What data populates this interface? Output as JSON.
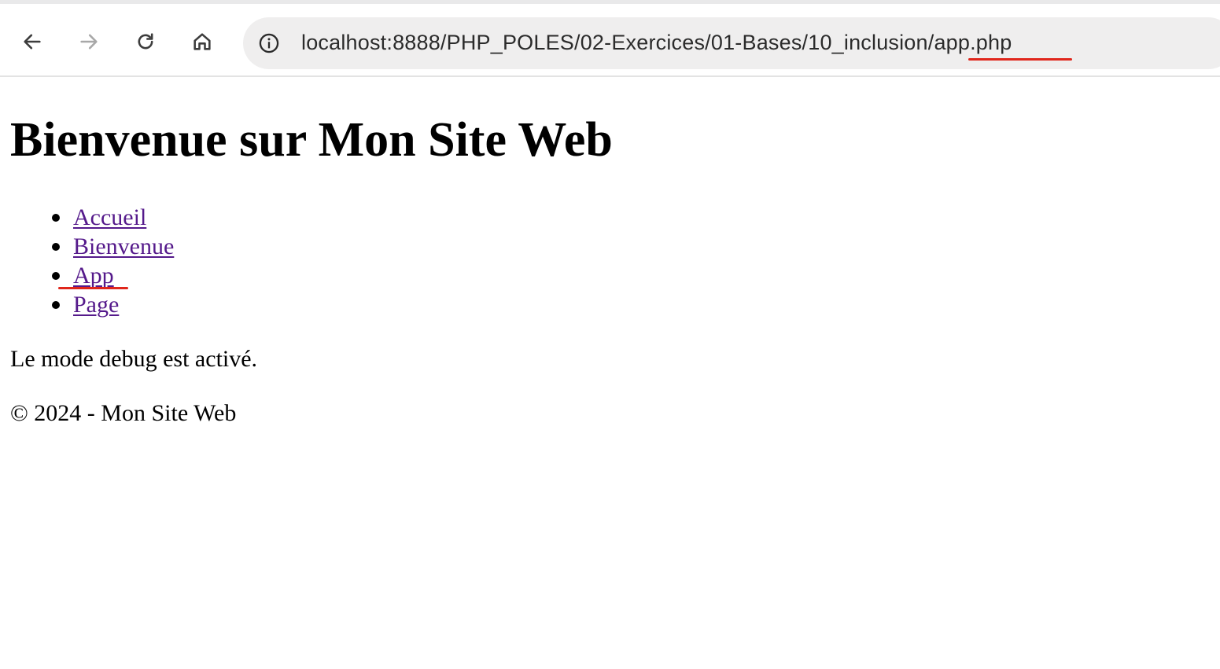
{
  "browser": {
    "url": "localhost:8888/PHP_POLES/02-Exercices/01-Bases/10_inclusion/app.php",
    "icons": {
      "back": "arrow-left-icon",
      "forward": "arrow-right-icon",
      "reload": "reload-icon",
      "home": "home-icon",
      "site_info": "info-icon"
    }
  },
  "page": {
    "heading": "Bienvenue sur Mon Site Web",
    "nav": [
      {
        "label": "Accueil"
      },
      {
        "label": "Bienvenue"
      },
      {
        "label": "App"
      },
      {
        "label": "Page"
      }
    ],
    "debug_message": "Le mode debug est activé.",
    "footer": "© 2024 - Mon Site Web"
  },
  "colors": {
    "link_visited": "#551a8b",
    "annotation_red": "#e0261b"
  }
}
